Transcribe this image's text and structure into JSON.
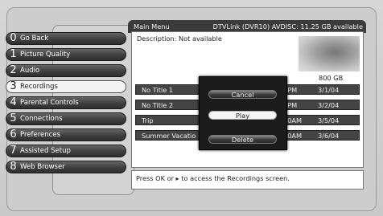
{
  "header": {
    "title": "Main Menu",
    "status": "DTVLink (DVR10) AVDISC: 11.25 GB available"
  },
  "menu": [
    {
      "num": "0",
      "label": "Go Back"
    },
    {
      "num": "1",
      "label": "Picture Quality"
    },
    {
      "num": "2",
      "label": "Audio"
    },
    {
      "num": "3",
      "label": "Recordings"
    },
    {
      "num": "4",
      "label": "Parental Controls"
    },
    {
      "num": "5",
      "label": "Connections"
    },
    {
      "num": "6",
      "label": "Preferences"
    },
    {
      "num": "7",
      "label": "Assisted Setup"
    },
    {
      "num": "8",
      "label": "Web Browser"
    }
  ],
  "selected_menu": "Recordings",
  "panel": {
    "description": "Description: Not available",
    "disk": "800 GB"
  },
  "recordings": [
    {
      "title": "No Title 1",
      "time": "0PM",
      "date": "3/1/04"
    },
    {
      "title": "No Title 2",
      "time": "0PM",
      "date": "3/2/04"
    },
    {
      "title": "Trip",
      "time": "00AM",
      "date": "3/5/04"
    },
    {
      "title": "Summer Vacatio",
      "time": "00AM",
      "date": "3/6/04"
    }
  ],
  "popup": {
    "cancel": "Cancel",
    "play": "Play",
    "delete": "Delete"
  },
  "help": "Press OK or ▸ to access the Recordings screen."
}
